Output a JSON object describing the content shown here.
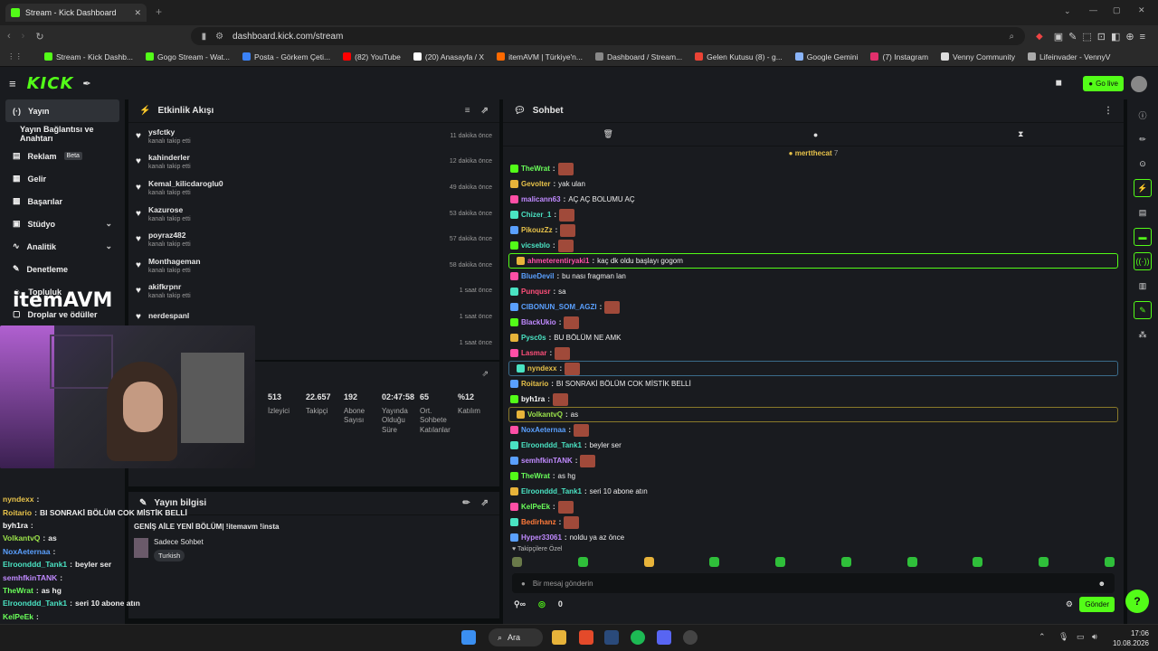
{
  "browser": {
    "tab_title": "Stream - Kick Dashboard",
    "url": "dashboard.kick.com/stream",
    "bookmarks": [
      "Stream - Kick Dashb...",
      "Gogo Stream - Wat...",
      "Posta - Görkem Çeti...",
      "(82) YouTube",
      "(20) Anasayfa / X",
      "itemAVM | Türkiye'n...",
      "Dashboard / Stream...",
      "Gelen Kutusu (8) - g...",
      "Google Gemini",
      "(7) Instagram",
      "Venny Community",
      "Lifeinvader - VennyV"
    ],
    "bookmark_colors": [
      "#53fc18",
      "#53fc18",
      "#3b82f6",
      "#ff0000",
      "#ffffff",
      "#ff6a00",
      "#888888",
      "#ea4335",
      "#8ab4f8",
      "#e1306c",
      "#dddddd",
      "#aaaaaa"
    ]
  },
  "header": {
    "logo": "KICK",
    "go_live": "Go live"
  },
  "sidebar": {
    "items": [
      {
        "label": "Yayın",
        "icon": "broadcast-icon"
      },
      {
        "label": "Yayın Bağlantısı ve Anahtarı",
        "icon": ""
      },
      {
        "label": "Reklam",
        "icon": "ad-icon",
        "badge": "Beta"
      },
      {
        "label": "Gelir",
        "icon": "revenue-icon"
      },
      {
        "label": "Başarılar",
        "icon": "trophy-icon"
      },
      {
        "label": "Stüdyo",
        "icon": "studio-icon"
      },
      {
        "label": "Analitik",
        "icon": "analytics-icon"
      },
      {
        "label": "Denetleme",
        "icon": "wrench-icon"
      },
      {
        "label": "Topluluk",
        "icon": "community-icon"
      },
      {
        "label": "Droplar ve ödüller",
        "icon": "gift-icon"
      }
    ]
  },
  "overlay_logo": "itemAVM",
  "activity": {
    "title": "Etkinlik Akışı",
    "events": [
      {
        "name": "ysfctky",
        "sub": "kanalı takip etti",
        "time": "11 dakika önce"
      },
      {
        "name": "kahinderler",
        "sub": "kanalı takip etti",
        "time": "12 dakika önce"
      },
      {
        "name": "Kemal_kilicdaroglu0",
        "sub": "kanalı takip etti",
        "time": "49 dakika önce"
      },
      {
        "name": "Kazurose",
        "sub": "kanalı takip etti",
        "time": "53 dakika önce"
      },
      {
        "name": "poyraz482",
        "sub": "kanalı takip etti",
        "time": "57 dakika önce"
      },
      {
        "name": "Monthageman",
        "sub": "kanalı takip etti",
        "time": "58 dakika önce"
      },
      {
        "name": "akifkrpnr",
        "sub": "kanalı takip etti",
        "time": "1 saat önce"
      },
      {
        "name": "nerdespanl",
        "sub": "",
        "time": "1 saat önce"
      },
      {
        "name": "",
        "sub": "",
        "time": "1 saat önce"
      }
    ]
  },
  "stats": [
    {
      "value": "513",
      "label": "İzleyici"
    },
    {
      "value": "22.657",
      "label": "Takipçi"
    },
    {
      "value": "192",
      "label": "Abone Sayısı"
    },
    {
      "value": "02:47:58",
      "label": "Yayında Olduğu Süre"
    },
    {
      "value": "65",
      "label": "Ort. Sohbete Katılanlar"
    },
    {
      "value": "%12",
      "label": "Katılım"
    }
  ],
  "info": {
    "title": "Yayın bilgisi",
    "stream_title": "GENİŞ AİLE YENİ BÖLÜM| !itemavm !insta",
    "category": "Sadece Sohbet",
    "language": "Turkish"
  },
  "overlay_chat": [
    {
      "user": "nyndexx",
      "color": "#e7c24a",
      "msg": ""
    },
    {
      "user": "Roitario",
      "color": "#e7c24a",
      "msg": "BI SONRAKİ BÖLÜM COK MİSTİK BELLİ"
    },
    {
      "user": "byh1ra",
      "color": "#ffffff",
      "msg": ""
    },
    {
      "user": "VolkantvQ",
      "color": "#9be34a",
      "msg": "as"
    },
    {
      "user": "NoxAeternaa",
      "color": "#5aa0ff",
      "msg": ""
    },
    {
      "user": "Elroonddd_Tank1",
      "color": "#4ae3c3",
      "msg": "beyler ser"
    },
    {
      "user": "semhfkinTANK",
      "color": "#c08aff",
      "msg": ""
    },
    {
      "user": "TheWrat",
      "color": "#6aff5a",
      "msg": "as hg"
    },
    {
      "user": "Elroonddd_Tank1",
      "color": "#4ae3c3",
      "msg": "seri 10 abone atın"
    },
    {
      "user": "KelPeEk",
      "color": "#6aff5a",
      "msg": ""
    },
    {
      "user": "Bedirhanz",
      "color": "#ff7a3a",
      "msg": ""
    },
    {
      "user": "Hyper33061",
      "color": "#c08aff",
      "msg": "noldu ya az önce"
    }
  ],
  "chat": {
    "title": "Sohbet",
    "pinned_user": "mertthecat",
    "pinned_count": "7",
    "messages": [
      {
        "user": "TheWrat",
        "color": "#6aff5a",
        "msg": "",
        "emote": true,
        "hl": ""
      },
      {
        "user": "Gevolter",
        "color": "#e7c24a",
        "msg": "yak ulan",
        "emote": false,
        "hl": ""
      },
      {
        "user": "malicann63",
        "color": "#c08aff",
        "msg": "AÇ AÇ BOLUMU AÇ",
        "emote": false,
        "hl": ""
      },
      {
        "user": "Chizer_1",
        "color": "#4ae3c3",
        "msg": "",
        "emote": true,
        "hl": ""
      },
      {
        "user": "PikouzZz",
        "color": "#e7c24a",
        "msg": "",
        "emote": true,
        "hl": ""
      },
      {
        "user": "vicseblo",
        "color": "#4ae3c3",
        "msg": "",
        "emote": true,
        "hl": ""
      },
      {
        "user": "ahmeterentiryaki1",
        "color": "#ff4fa6",
        "msg": "kaç dk oldu başlayı gogom",
        "emote": false,
        "hl": "hl"
      },
      {
        "user": "BlueDevil",
        "color": "#5aa0ff",
        "msg": "bu nası fragman lan",
        "emote": false,
        "hl": ""
      },
      {
        "user": "Punqusr",
        "color": "#ff4f7a",
        "msg": "sa",
        "emote": false,
        "hl": ""
      },
      {
        "user": "CIBONUN_SOM_AGZI",
        "color": "#5aa0ff",
        "msg": "",
        "emote": true,
        "hl": ""
      },
      {
        "user": "BlackUkio",
        "color": "#c08aff",
        "msg": "",
        "emote": true,
        "hl": ""
      },
      {
        "user": "Pysc0s",
        "color": "#4ae3c3",
        "msg": "BU BÖLÜM NE AMK",
        "emote": false,
        "hl": ""
      },
      {
        "user": "Lasmar",
        "color": "#ff4f7a",
        "msg": "",
        "emote": true,
        "hl": ""
      },
      {
        "user": "nyndexx",
        "color": "#e7c24a",
        "msg": "",
        "emote": true,
        "hl": "hl2"
      },
      {
        "user": "Roitario",
        "color": "#e7c24a",
        "msg": "BI SONRAKİ BÖLÜM COK MİSTİK BELLİ",
        "emote": false,
        "hl": ""
      },
      {
        "user": "byh1ra",
        "color": "#ffffff",
        "msg": "",
        "emote": true,
        "hl": ""
      },
      {
        "user": "VolkantvQ",
        "color": "#9be34a",
        "msg": "as",
        "emote": false,
        "hl": "hl3"
      },
      {
        "user": "NoxAeternaa",
        "color": "#5aa0ff",
        "msg": "",
        "emote": true,
        "hl": ""
      },
      {
        "user": "Elroonddd_Tank1",
        "color": "#4ae3c3",
        "msg": "beyler ser",
        "emote": false,
        "hl": ""
      },
      {
        "user": "semhfkinTANK",
        "color": "#c08aff",
        "msg": "",
        "emote": true,
        "hl": ""
      },
      {
        "user": "TheWrat",
        "color": "#6aff5a",
        "msg": "as hg",
        "emote": false,
        "hl": ""
      },
      {
        "user": "Elroonddd_Tank1",
        "color": "#4ae3c3",
        "msg": "seri 10 abone atın",
        "emote": false,
        "hl": ""
      },
      {
        "user": "KelPeEk",
        "color": "#6aff5a",
        "msg": "",
        "emote": true,
        "hl": ""
      },
      {
        "user": "Bedirhanz",
        "color": "#ff7a3a",
        "msg": "",
        "emote": true,
        "hl": ""
      },
      {
        "user": "Hyper33061",
        "color": "#c08aff",
        "msg": "noldu ya az önce",
        "emote": false,
        "hl": ""
      }
    ],
    "followers_only": "Takipçilere Özel",
    "input_placeholder": "Bir mesaj gönderin",
    "send_label": "Gönder",
    "viewer_count": "0"
  },
  "taskbar": {
    "search": "Ara",
    "time": "17:06",
    "date": "10.08.2026"
  }
}
